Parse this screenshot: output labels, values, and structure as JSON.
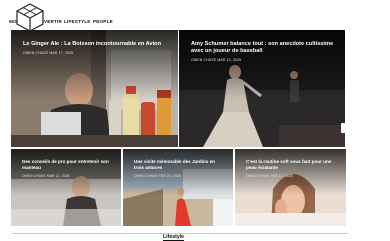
{
  "nav": {
    "items": [
      {
        "label": "MODE"
      },
      {
        "label": "SE DIVERTIR"
      },
      {
        "label": "LIFESTYLE"
      },
      {
        "label": "PEOPLE"
      }
    ]
  },
  "featured": [
    {
      "title": "Le Ginger Ale : La Boisson incontournable en Avion",
      "meta": "OWEN CHASE  MAR 17, 2025"
    },
    {
      "title": "Amy Schumer balance tout : son anecdote cultissime avec un joueur de baseball",
      "meta": "OWEN CHASE  MAR 13, 2025"
    }
  ],
  "grid": [
    {
      "title": "Des conseils de pro pour entretenir son manteau",
      "meta": "OWEN CHASE  MAR 12, 2025"
    },
    {
      "title": "Une visite mémorable des Jardins en trois astuces",
      "meta": "OWEN CHASE  FEB 26, 2025"
    },
    {
      "title": "C'est la routine soft vous faut pour une peau éclatante",
      "meta": "OWEN CHASE  FEB 17, 2025"
    }
  ],
  "section": {
    "label": "Lifestyle"
  },
  "colors": {
    "text": "#111111",
    "overlay": "#000000",
    "white": "#ffffff"
  }
}
